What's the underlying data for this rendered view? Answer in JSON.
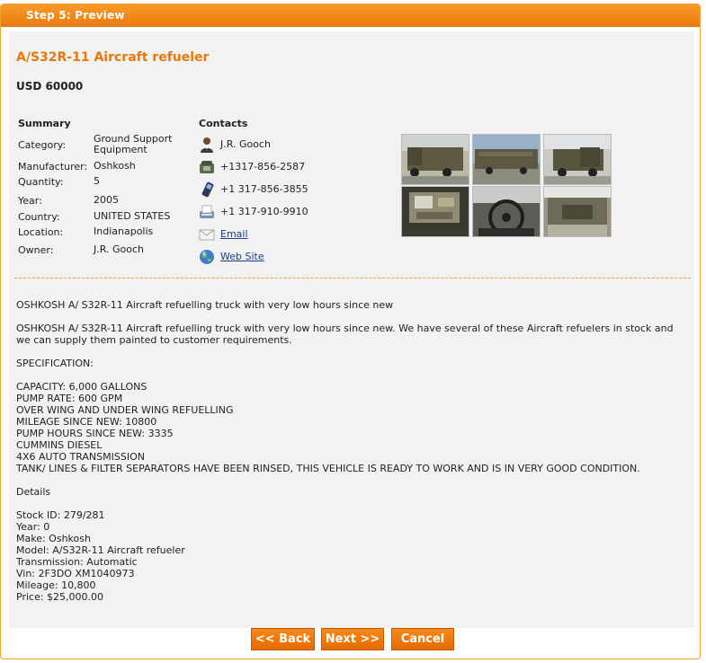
{
  "header": {
    "title": "Step 5: Preview"
  },
  "item": {
    "title": "A/S32R-11 Aircraft refueler",
    "price": "USD 60000"
  },
  "summary": {
    "heading": "Summary",
    "rows": [
      {
        "label": "Category:",
        "value": "Ground Support Equipment"
      },
      {
        "label": "Manufacturer:",
        "value": "Oshkosh"
      },
      {
        "label": "Quantity:",
        "value": "5"
      },
      {
        "label": "Year:",
        "value": "2005"
      },
      {
        "label": "Country:",
        "value": "UNITED STATES"
      },
      {
        "label": "Location:",
        "value": "Indianapolis"
      },
      {
        "label": "Owner:",
        "value": "J.R. Gooch"
      }
    ]
  },
  "contacts": {
    "heading": "Contacts",
    "name": "J.R. Gooch",
    "phone": "+1317-856-2587",
    "mobile": "+1 317-856-3855",
    "fax": "+1 317-910-9910",
    "email_label": "Email",
    "website_label": "Web Site"
  },
  "description": {
    "intro": "OSHKOSH A/ S32R-11 Aircraft refuelling truck with very low hours since new",
    "paragraph": "OSHKOSH A/ S32R-11 Aircraft refuelling truck with very low hours since new. We have several of these Aircraft refuelers in stock and we can supply them painted to customer requirements.",
    "spec_heading": "SPECIFICATION:",
    "spec_lines": "CAPACITY: 6,000 GALLONS\nPUMP RATE: 600 GPM\nOVER WING AND UNDER WING REFUELLING\nMILEAGE SINCE NEW: 10800\nPUMP HOURS SINCE NEW: 3335\nCUMMINS DIESEL\n4X6 AUTO TRANSMISSION\nTANK/ LINES & FILTER SEPARATORS HAVE BEEN RINSED, THIS VEHICLE IS READY TO WORK AND IS IN VERY GOOD CONDITION.",
    "details_heading": "Details",
    "details_lines": "Stock ID: 279/281\nYear: 0\nMake: Oshkosh\nModel: A/S32R-11 Aircraft refueler\nTransmission: Automatic\nVin: 2F3DO XM1040973\nMileage: 10,800\nPrice: $25,000.00"
  },
  "buttons": {
    "back": "<< Back",
    "next": "Next >>",
    "cancel": "Cancel"
  },
  "colors": {
    "accent": "#ea7a0c",
    "title": "#e8780c",
    "panel": "#f2f2f2",
    "link": "#1a3c8c"
  }
}
